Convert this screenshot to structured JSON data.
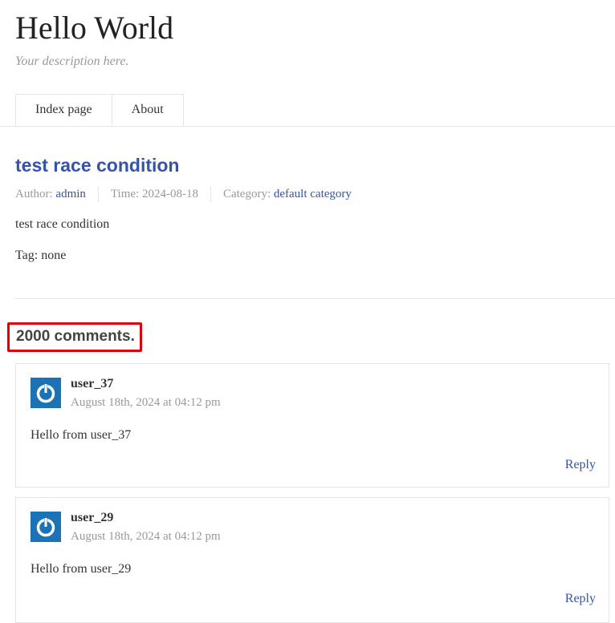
{
  "site": {
    "title": "Hello World",
    "description": "Your description here."
  },
  "nav": {
    "items": [
      {
        "label": "Index page"
      },
      {
        "label": "About"
      }
    ]
  },
  "post": {
    "title": "test race condition",
    "meta": {
      "author_label": "Author:",
      "author": "admin",
      "time_label": "Time:",
      "time": "2024-08-18",
      "category_label": "Category:",
      "category": "default category"
    },
    "content": "test race condition",
    "tags": "Tag: none"
  },
  "comments": {
    "count_label": "2000 comments.",
    "items": [
      {
        "author": "user_37",
        "date": "August 18th, 2024 at 04:12 pm",
        "body": "Hello from user_37",
        "reply_label": "Reply"
      },
      {
        "author": "user_29",
        "date": "August 18th, 2024 at 04:12 pm",
        "body": "Hello from user_29",
        "reply_label": "Reply"
      }
    ]
  },
  "colors": {
    "link": "#3354aa",
    "highlight_border": "#e0000a",
    "avatar_bg": "#1b73b6"
  }
}
